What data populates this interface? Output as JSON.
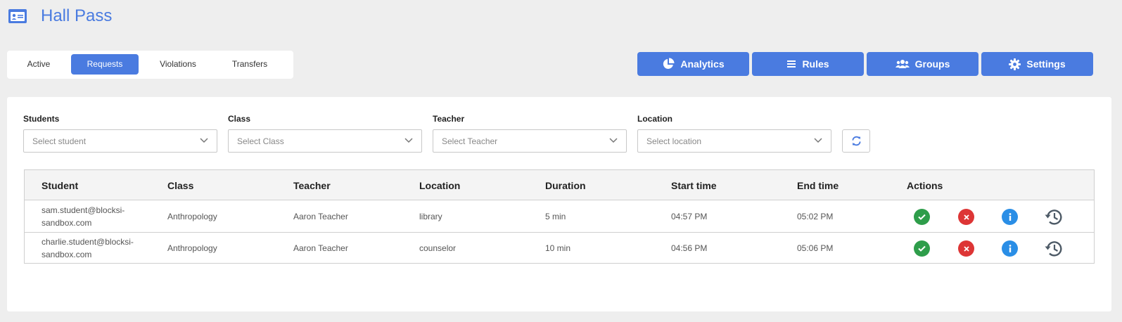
{
  "app": {
    "title": "Hall Pass",
    "icon": "id-card-icon"
  },
  "tabs": [
    {
      "label": "Active"
    },
    {
      "label": "Requests",
      "active": true
    },
    {
      "label": "Violations"
    },
    {
      "label": "Transfers"
    }
  ],
  "toolbar": {
    "analytics": {
      "label": "Analytics",
      "icon": "pie-chart-icon"
    },
    "rules": {
      "label": "Rules",
      "icon": "list-icon"
    },
    "groups": {
      "label": "Groups",
      "icon": "users-icon"
    },
    "settings": {
      "label": "Settings",
      "icon": "gear-icon"
    }
  },
  "filters": {
    "students": {
      "label": "Students",
      "placeholder": "Select student"
    },
    "class": {
      "label": "Class",
      "placeholder": "Select Class"
    },
    "teacher": {
      "label": "Teacher",
      "placeholder": "Select Teacher"
    },
    "location": {
      "label": "Location",
      "placeholder": "Select location"
    },
    "refresh_icon": "refresh-icon"
  },
  "table": {
    "headers": [
      "Student",
      "Class",
      "Teacher",
      "Location",
      "Duration",
      "Start time",
      "End time",
      "Actions"
    ],
    "rows": [
      {
        "student_line1": "sam.student@blocksi-",
        "student_line2": "sandbox.com",
        "class": "Anthropology",
        "teacher": "Aaron Teacher",
        "location": "library",
        "duration": "5 min",
        "start": "04:57 PM",
        "end": "05:02 PM"
      },
      {
        "student_line1": "charlie.student@blocksi-",
        "student_line2": "sandbox.com",
        "class": "Anthropology",
        "teacher": "Aaron Teacher",
        "location": "counselor",
        "duration": "10 min",
        "start": "04:56 PM",
        "end": "05:06 PM"
      }
    ],
    "action_icons": [
      "approve-icon",
      "deny-icon",
      "info-icon",
      "history-icon"
    ]
  },
  "colors": {
    "brand": "#4a7be0",
    "approve": "#2e9d4a",
    "deny": "#dd3535",
    "info": "#2a8ee6",
    "history": "#4d5a66"
  }
}
